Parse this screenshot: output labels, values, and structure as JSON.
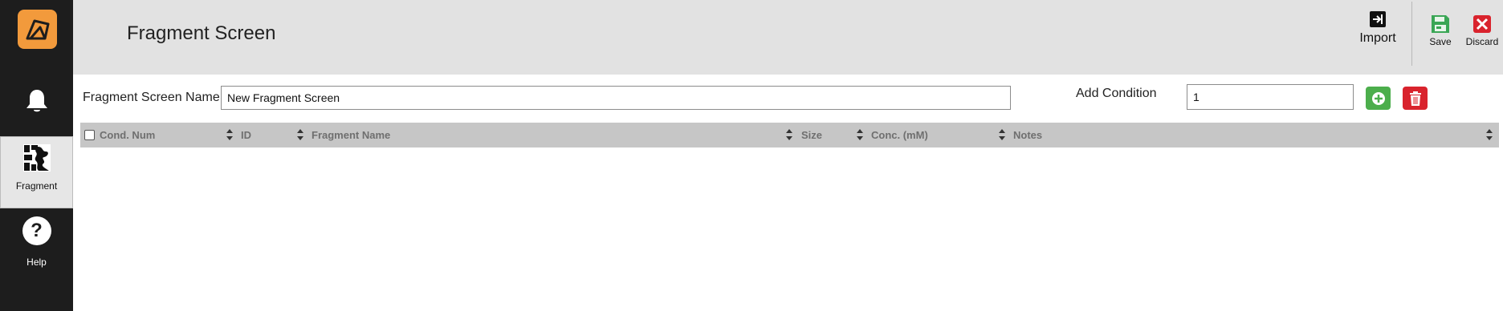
{
  "header": {
    "title": "Fragment Screen",
    "import_label": "Import",
    "save_label": "Save",
    "discard_label": "Discard"
  },
  "sidebar": {
    "items": [
      {
        "label": ""
      },
      {
        "label": "Fragment"
      },
      {
        "label": "Help"
      }
    ]
  },
  "form": {
    "name_label": "Fragment Screen Name",
    "name_value": "New Fragment Screen",
    "add_condition_label": "Add Condition",
    "add_condition_value": "1"
  },
  "table": {
    "columns": [
      "Cond. Num",
      "ID",
      "Fragment Name",
      "Size",
      "Conc. (mM)",
      "Notes"
    ],
    "rows": []
  },
  "colors": {
    "sidebar": "#1d1d1d",
    "header": "#e2e2e2",
    "accent_orange": "#f29a3c",
    "add_green": "#4cae4c",
    "delete_red": "#d9232d",
    "save_green": "#3aa655",
    "discard_red": "#d9232d"
  },
  "icons": [
    "logo-icon",
    "bell-icon",
    "fragment-icon",
    "help-icon",
    "import-icon",
    "save-icon",
    "discard-icon",
    "plus-icon",
    "trash-icon",
    "sort-icon"
  ]
}
